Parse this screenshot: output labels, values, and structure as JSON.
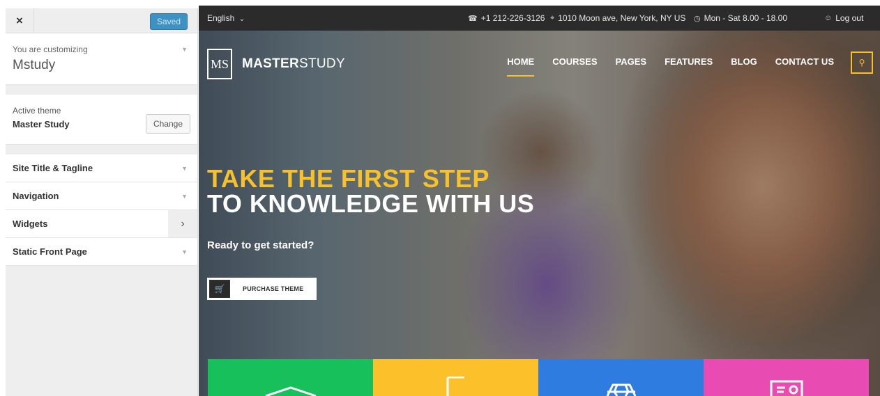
{
  "customizer": {
    "close_label": "×",
    "saved_label": "Saved",
    "customizing_label": "You are customizing",
    "site_name": "Mstudy",
    "active_theme_label": "Active theme",
    "active_theme_name": "Master Study",
    "change_label": "Change",
    "sections": [
      {
        "label": "Site Title & Tagline"
      },
      {
        "label": "Navigation"
      },
      {
        "label": "Widgets"
      },
      {
        "label": "Static Front Page"
      }
    ]
  },
  "preview": {
    "topbar": {
      "language": "English",
      "phone": "+1 212-226-3126",
      "address": "1010 Moon ave, New York, NY US",
      "hours": "Mon - Sat 8.00 - 18.00",
      "logout": "Log out"
    },
    "logo": {
      "mark": "MS",
      "bold": "MASTER",
      "light": "STUDY"
    },
    "nav": [
      "HOME",
      "COURSES",
      "PAGES",
      "FEATURES",
      "BLOG",
      "CONTACT US"
    ],
    "hero": {
      "headline_line1": "TAKE THE FIRST STEP",
      "headline_line2": "TO KNOWLEDGE WITH US",
      "subline": "Ready to get started?",
      "cta_label": "PURCHASE THEME"
    },
    "tiles": [
      {
        "color": "#17c05a",
        "icon": "graduation-cap-icon"
      },
      {
        "color": "#fcc12a",
        "icon": "book-icon"
      },
      {
        "color": "#2e7ce0",
        "icon": "diamond-icon"
      },
      {
        "color": "#e84bb2",
        "icon": "id-card-icon"
      }
    ]
  },
  "colors": {
    "accent": "#f6c12b",
    "saved_button": "#3d92c3",
    "topbar": "#2b2b2b"
  }
}
